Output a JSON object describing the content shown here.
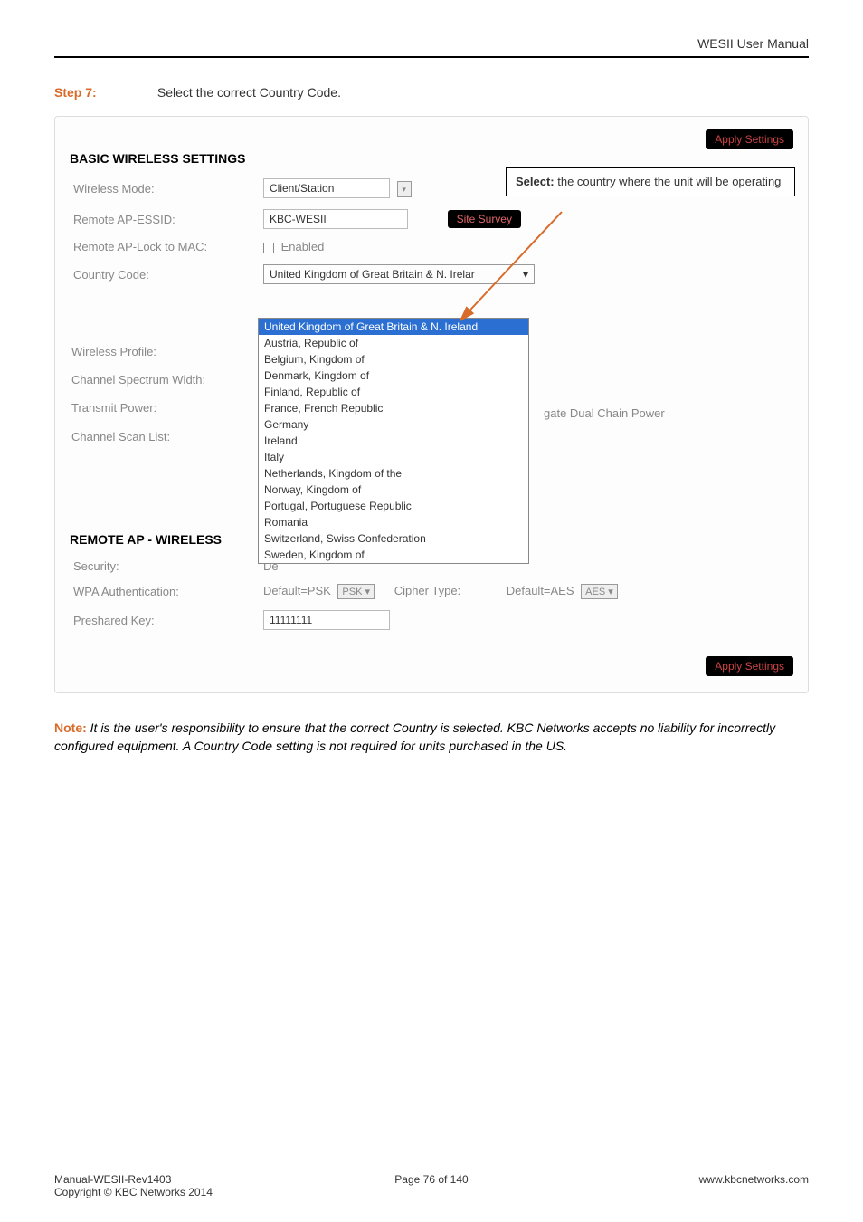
{
  "header": {
    "title": "WESII User Manual"
  },
  "step": {
    "label": "Step 7:",
    "text": "Select the correct Country Code."
  },
  "buttons": {
    "apply": "Apply Settings",
    "site_survey": "Site Survey"
  },
  "basic": {
    "heading": "BASIC WIRELESS SETTINGS",
    "callout_prefix": "Select:",
    "callout_text": " the country where the unit will be operating",
    "wireless_mode_label": "Wireless Mode:",
    "wireless_mode_value": "Client/Station",
    "remote_ap_essid_label": "Remote AP-ESSID:",
    "remote_ap_essid_value": "KBC-WESII",
    "remote_ap_lock_label": "Remote AP-Lock to MAC:",
    "remote_ap_lock_value": "Enabled",
    "country_code_label": "Country Code:",
    "country_code_value": "United Kingdom of Great Britain & N. Irelar",
    "wireless_profile_label": "Wireless Profile:",
    "channel_spectrum_label": "Channel Spectrum Width:",
    "transmit_power_label": "Transmit Power:",
    "channel_scan_label": "Channel Scan List:",
    "dual_chain_label": "gate Dual Chain Power",
    "options": [
      "United Kingdom of Great Britain & N. Ireland",
      "Austria, Republic of",
      "Belgium, Kingdom of",
      "Denmark, Kingdom of",
      "Finland, Republic of",
      "France, French Republic",
      "Germany",
      "Ireland",
      "Italy",
      "Netherlands, Kingdom of the",
      "Norway, Kingdom of",
      "Portugal, Portuguese Republic",
      "Romania",
      "Switzerland, Swiss Confederation",
      "Sweden, Kingdom of"
    ]
  },
  "remote": {
    "heading": "REMOTE AP - WIRELESS",
    "security_label": "Security:",
    "security_prefix": "De",
    "wpa_auth_label": "WPA Authentication:",
    "wpa_auth_value": "Default=PSK",
    "wpa_auth_sel": "PSK",
    "cipher_label": "Cipher Type:",
    "cipher_value": "Default=AES",
    "cipher_sel": "AES",
    "preshared_label": "Preshared Key:",
    "preshared_value": "11111111"
  },
  "note": {
    "label": "Note:",
    "text": "It is the user's responsibility to ensure that the correct Country is selected. KBC Networks accepts no liability for incorrectly configured equipment. A Country Code setting is not required for units purchased in the US."
  },
  "footer": {
    "line1": "Manual-WESII-Rev1403",
    "line2": "Copyright © KBC Networks 2014",
    "center": "Page 76 of 140",
    "right": "www.kbcnetworks.com"
  }
}
